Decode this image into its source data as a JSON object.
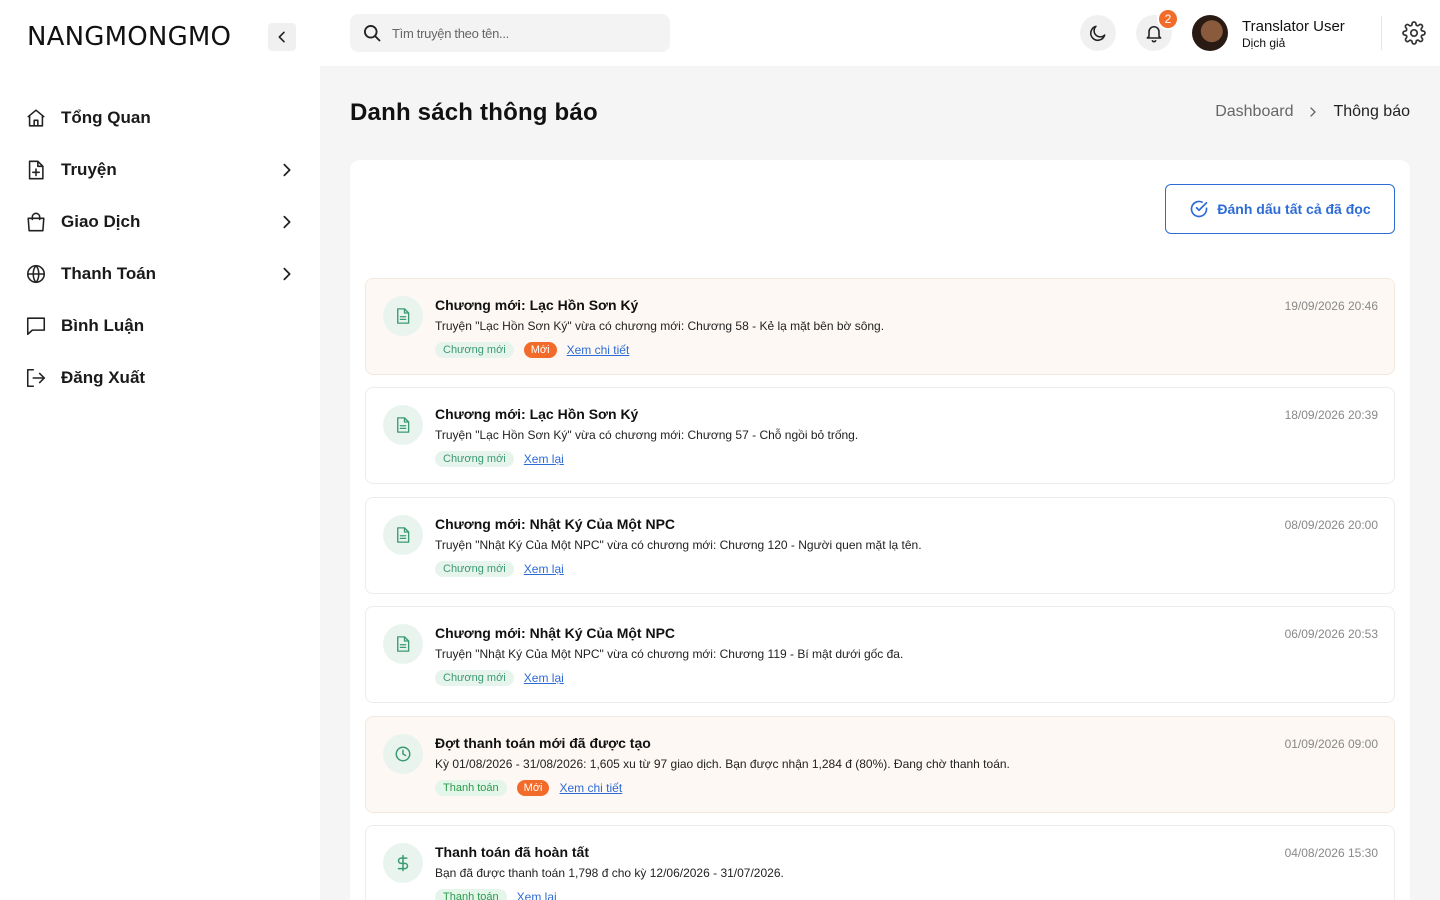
{
  "brand": "NANGMONGMO",
  "sidebar": {
    "items": [
      {
        "label": "Tổng Quan",
        "icon": "home-icon",
        "has_chevron": false
      },
      {
        "label": "Truyện",
        "icon": "file-plus-icon",
        "has_chevron": true
      },
      {
        "label": "Giao Dịch",
        "icon": "shopping-bag-icon",
        "has_chevron": true
      },
      {
        "label": "Thanh Toán",
        "icon": "globe-icon",
        "has_chevron": true
      },
      {
        "label": "Bình Luận",
        "icon": "message-square-icon",
        "has_chevron": false
      },
      {
        "label": "Đăng Xuất",
        "icon": "logout-icon",
        "has_chevron": false
      }
    ]
  },
  "topbar": {
    "search_placeholder": "Tìm truyện theo tên...",
    "notification_count": "2",
    "user_name": "Translator User",
    "user_role": "Dịch giả"
  },
  "header": {
    "title": "Danh sách thông báo",
    "breadcrumb": {
      "parent": "Dashboard",
      "current": "Thông báo"
    }
  },
  "actions": {
    "mark_all_read": "Đánh dấu tất cả đã đọc"
  },
  "notifications": [
    {
      "title": "Chương mới: Lạc Hồn Sơn Ký",
      "message": "Truyện \"Lạc Hồn Sơn Ký\" vừa có chương mới: Chương 58 - Kẻ lạ mặt bên bờ sông.",
      "tag": "Chương mới",
      "new_label": "Mới",
      "link": "Xem chi tiết",
      "time": "19/09/2026 20:46",
      "unread": true,
      "icon": "document-icon"
    },
    {
      "title": "Chương mới: Lạc Hồn Sơn Ký",
      "message": "Truyện \"Lạc Hồn Sơn Ký\" vừa có chương mới: Chương 57 - Chỗ ngồi bỏ trống.",
      "tag": "Chương mới",
      "new_label": "",
      "link": "Xem lại",
      "time": "18/09/2026 20:39",
      "unread": false,
      "icon": "document-icon"
    },
    {
      "title": "Chương mới: Nhật Ký Của Một NPC",
      "message": "Truyện \"Nhật Ký Của Một NPC\" vừa có chương mới: Chương 120 - Người quen mặt lạ tên.",
      "tag": "Chương mới",
      "new_label": "",
      "link": "Xem lại",
      "time": "08/09/2026 20:00",
      "unread": false,
      "icon": "document-icon"
    },
    {
      "title": "Chương mới: Nhật Ký Của Một NPC",
      "message": "Truyện \"Nhật Ký Của Một NPC\" vừa có chương mới: Chương 119 - Bí mật dưới gốc đa.",
      "tag": "Chương mới",
      "new_label": "",
      "link": "Xem lại",
      "time": "06/09/2026 20:53",
      "unread": false,
      "icon": "document-icon"
    },
    {
      "title": "Đợt thanh toán mới đã được tạo",
      "message": "Kỳ 01/08/2026 - 31/08/2026: 1,605 xu từ 97 giao dịch. Bạn được nhận 1,284 đ (80%). Đang chờ thanh toán.",
      "tag": "Thanh toán",
      "new_label": "Mới",
      "link": "Xem chi tiết",
      "time": "01/09/2026 09:00",
      "unread": true,
      "icon": "clock-icon"
    },
    {
      "title": "Thanh toán đã hoàn tất",
      "message": "Bạn đã được thanh toán 1,798 đ cho kỳ 12/06/2026 - 31/07/2026.",
      "tag": "Thanh toán",
      "new_label": "",
      "link": "Xem lại",
      "time": "04/08/2026 15:30",
      "unread": false,
      "icon": "dollar-icon"
    }
  ],
  "colors": {
    "accent": "#2d6bd6",
    "badge": "#f26b2a",
    "icon_green": "#3a9a72"
  }
}
